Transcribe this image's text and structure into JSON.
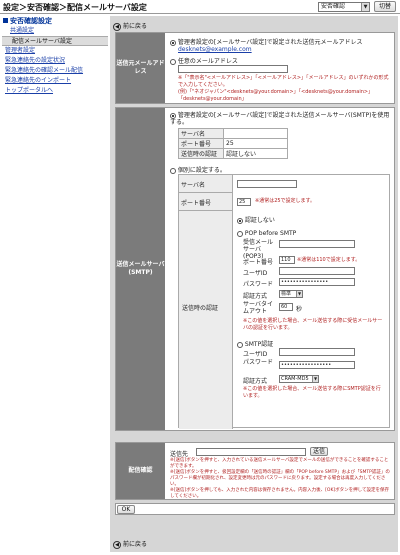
{
  "header": {
    "title": "設定＞安否確認＞配信メールサーバ設定",
    "product_select": "安否確認",
    "switch_button": "切替"
  },
  "sidebar": {
    "title": "安否確認設定",
    "items": [
      {
        "label": "共通設定"
      },
      {
        "label": "配信メールサーバ設定"
      },
      {
        "label": "管理者設定"
      },
      {
        "label": "緊急連絡先の設定状況"
      },
      {
        "label": "緊急連絡先の確認メール配信"
      },
      {
        "label": "緊急連絡先のインポート"
      },
      {
        "label": "トップポータルへ"
      }
    ]
  },
  "nav": {
    "back_label": "前に戻る"
  },
  "sender": {
    "section_label": "送信元メールアドレス",
    "option1": "管理者設定の[メールサーバ設定]で設定された送信元メールアドレス",
    "option1_link": "desknets@example.com",
    "option2": "任意のメールアドレス",
    "note1": "※「\"表示名\"<メールアドレス>」「<メールアドレス>」「メールアドレス」のいずれかの形式で入力してください。",
    "note2": "(例)「\"ネオジャパン\"<desknets@your.domain>」「<desknets@your.domain>」「desknets@your.domain」"
  },
  "smtp": {
    "section_label": "送信メールサーバ(SMTP)",
    "option1": "管理者設定の[メールサーバ設定]で設定された送信メールサーバ(SMTP)を使用する。",
    "server_name_label": "サーバ名",
    "port_label": "ポート番号",
    "port_value": "25",
    "auth_label": "送信時の認証",
    "auth_value": "認証しない",
    "option2": "個別に設定する。",
    "port_input": "25",
    "port_note": "※通常は25で設定します。",
    "auth_none": "認証しない",
    "pop_before_smtp": "POP before SMTP",
    "pop_server_label": "受信メールサーバ(POP3)",
    "pop_port_label": "ポート番号",
    "pop_port_value": "110",
    "pop_port_note": "※通常は110で設定します。",
    "user_id_label": "ユーザID",
    "password_label": "パスワード",
    "password_value": "••••••••••••••••",
    "auth_method_label": "認証方式",
    "auth_method_value": "標準",
    "timeout_label": "サーバタイムアウト",
    "timeout_value": "60",
    "timeout_unit": "秒",
    "pop_note": "※この値を選択した場合、メール送信する際に受信メールサーバの認証を行います。",
    "smtp_auth": "SMTP認証",
    "smtp_user_label": "ユーザID",
    "smtp_password_label": "パスワード",
    "smtp_password_value": "•••••••••••••••••",
    "smtp_auth_method_label": "認証方式",
    "smtp_auth_method_value": "CRAM-MD5",
    "smtp_note": "※この値を選択した場合、メール送信する際にSMTP認証を行います。"
  },
  "delivery": {
    "section_label": "配信確認",
    "to_label": "送信先",
    "send_button": "送信",
    "notes": [
      "※[送信]ボタンを押すと、入力されている送信メールサーバ設定でメールの送信ができることを確認することができます。",
      "※[送信]ボタンを押すと、扱回設定欄の「送信時の認証」欄の「POP before SMTP」および「SMTP認証」のパスワード欄が初期化され、設定変更時は元のパスワードに戻ります。設定する場合は再度入力してください。",
      "※[送信]ボタンを押しても、入力された内容は保存されません。内容入力後、[OK]ボタンを押して設定を保存してください。"
    ]
  },
  "ok_button": "OK"
}
